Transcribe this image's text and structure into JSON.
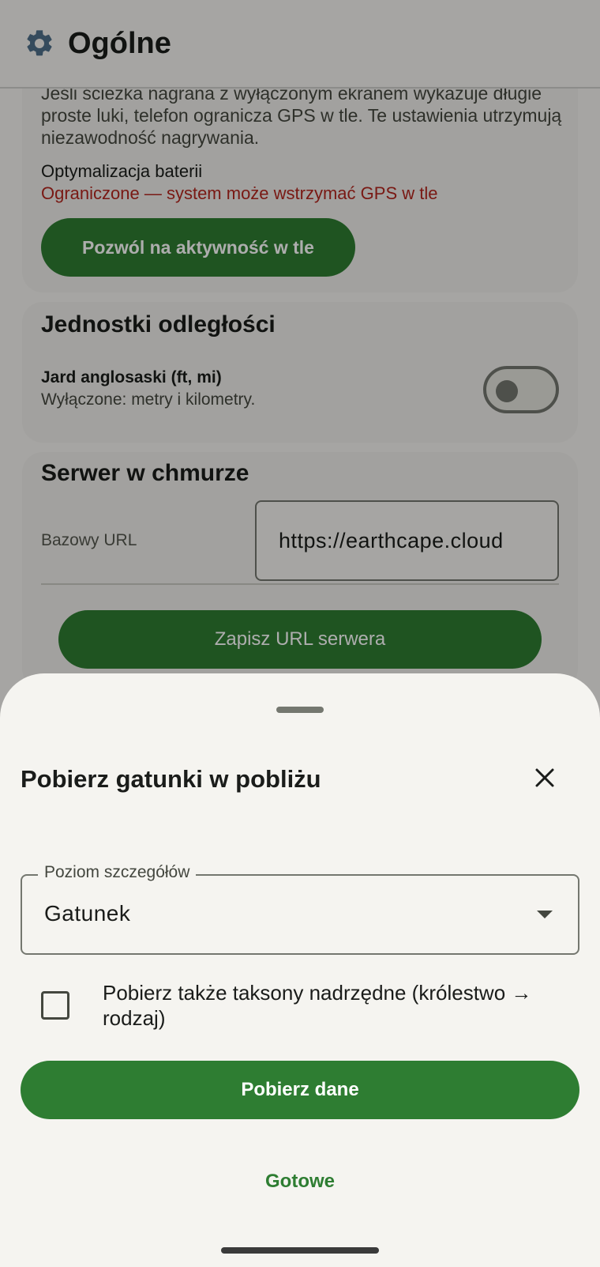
{
  "appbar": {
    "title": "Ogólne",
    "icon": "gear-icon"
  },
  "background_info": {
    "description": "Jeśli ścieżka nagrana z wyłączonym ekranem wykazuje długie proste luki, telefon ogranicza GPS w tle. Te ustawienia utrzymują niezawodność nagrywania.",
    "battery_label": "Optymalizacja baterii",
    "battery_status": "Ograniczone — system może wstrzymać GPS w tle",
    "allow_background_button": "Pozwól na aktywność w tle"
  },
  "distance_units": {
    "title": "Jednostki odległości",
    "imperial_label": "Jard anglosaski (ft, mi)",
    "imperial_subtitle": "Wyłączone: metry i kilometry.",
    "imperial_enabled": false
  },
  "cloud_server": {
    "title": "Serwer w chmurze",
    "base_url_label": "Bazowy URL",
    "base_url_value": "https://earthcape.cloud",
    "save_button": "Zapisz URL serwera"
  },
  "sheet": {
    "title": "Pobierz gatunki w pobliżu",
    "detail_level_label": "Poziom szczegółów",
    "detail_level_value": "Gatunek",
    "parent_taxa_checkbox_label": "Pobierz także taksony nadrzędne (królestwo → rodzaj)",
    "parent_taxa_checked": false,
    "download_button": "Pobierz dane",
    "done_button": "Gotowe"
  },
  "colors": {
    "primary": "#2e7d32",
    "error": "#b3261e",
    "surface": "#f5f4f0"
  }
}
